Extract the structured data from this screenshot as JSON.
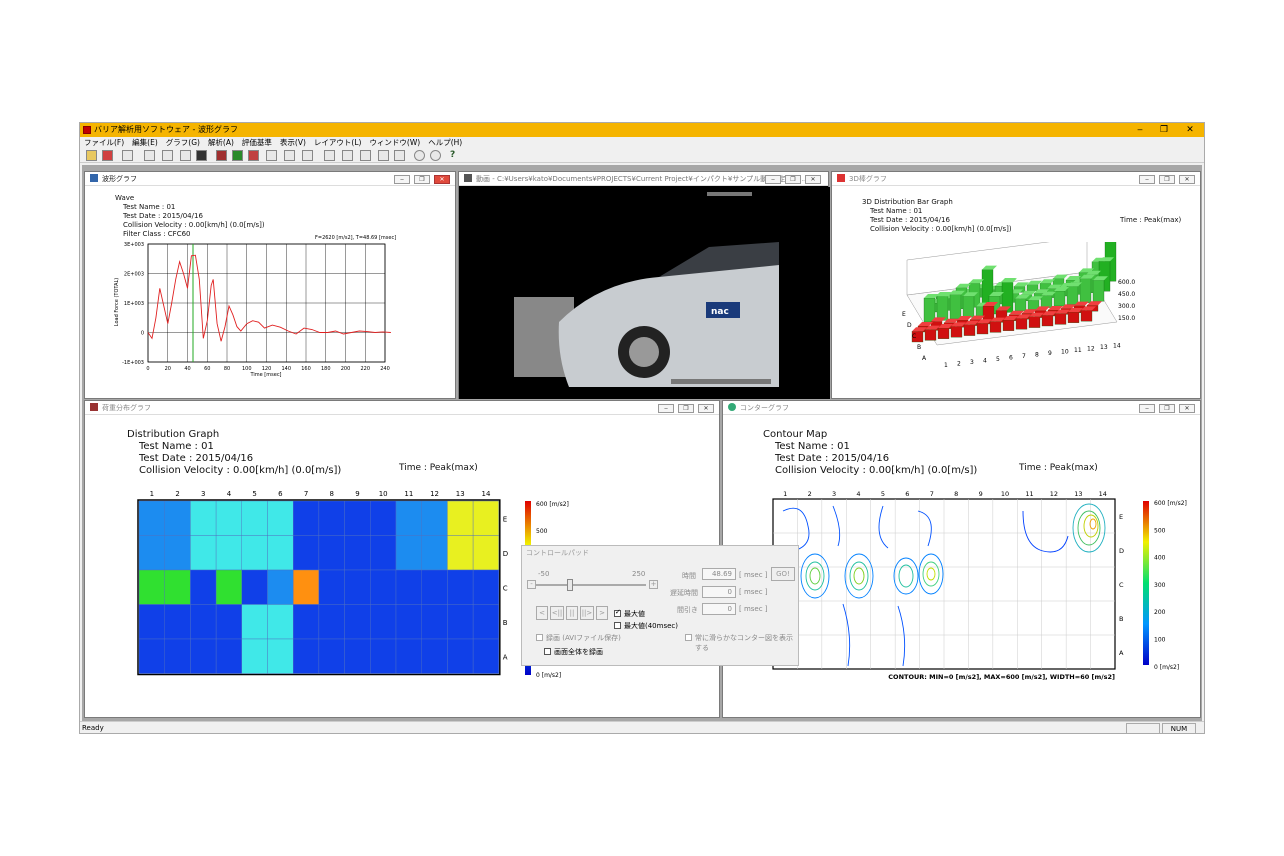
{
  "app": {
    "title": "バリア解析用ソフトウェア - 波形グラフ"
  },
  "menu": [
    "ファイル(F)",
    "編集(E)",
    "グラフ(G)",
    "解析(A)",
    "評価基準",
    "表示(V)",
    "レイアウト(L)",
    "ウィンドウ(W)",
    "ヘルプ(H)"
  ],
  "windows": {
    "wave": {
      "title": "波形グラフ",
      "heading": "Wave",
      "test_name": "Test Name : 01",
      "test_date": "Test Date : 2015/04/16",
      "velocity": "Collision Velocity : 0.00[km/h] (0.0[m/s])",
      "filter": "Filter Class : CFC60",
      "readout": "F=2620 [m/s2],  T=48.69 [msec]",
      "ylabel": "Load Force (TOTAL)",
      "xlabel": "Time [msec]",
      "yticks": [
        "3E+003",
        "2E+003",
        "1E+003",
        "0",
        "-1E+003"
      ],
      "xticks": [
        "0",
        "20",
        "40",
        "60",
        "80",
        "100",
        "120",
        "140",
        "160",
        "180",
        "200",
        "220",
        "240"
      ]
    },
    "video": {
      "title": "動画 - C:¥Users¥kato¥Documents¥PROJECTS¥Current Project¥インパクト¥サンプル動画¥定全要..."
    },
    "bar3d": {
      "title": "3D棒グラフ",
      "heading": "3D Distribution Bar Graph",
      "test_name": "Test Name : 01",
      "test_date": "Test Date : 2015/04/16",
      "velocity": "Collision Velocity : 0.00[km/h] (0.0[m/s])",
      "time": "Time : Peak(max)",
      "zticks": [
        "600.0",
        "450.0",
        "300.0",
        "150.0"
      ],
      "rows": [
        "A",
        "B",
        "C",
        "D",
        "E"
      ],
      "cols": [
        "1",
        "2",
        "3",
        "4",
        "5",
        "6",
        "7",
        "8",
        "9",
        "10",
        "11",
        "12",
        "13",
        "14"
      ]
    },
    "dist": {
      "title": "荷重分布グラフ",
      "heading": "Distribution Graph",
      "test_name": "Test Name : 01",
      "test_date": "Test Date : 2015/04/16",
      "velocity": "Collision Velocity : 0.00[km/h] (0.0[m/s])",
      "time": "Time : Peak(max)",
      "cols": [
        "1",
        "2",
        "3",
        "4",
        "5",
        "6",
        "7",
        "8",
        "9",
        "10",
        "11",
        "12",
        "13",
        "14"
      ],
      "rows": [
        "E",
        "D",
        "C",
        "B",
        "A"
      ],
      "scale_top": "600 [m/s2]",
      "scale_500": "500",
      "scale_bottom": "0 [m/s2]"
    },
    "contour": {
      "title": "コンターグラフ",
      "heading": "Contour Map",
      "test_name": "Test Name : 01",
      "test_date": "Test Date : 2015/04/16",
      "velocity": "Collision Velocity : 0.00[km/h] (0.0[m/s])",
      "time": "Time : Peak(max)",
      "cols": [
        "1",
        "2",
        "3",
        "4",
        "5",
        "6",
        "7",
        "8",
        "9",
        "10",
        "11",
        "12",
        "13",
        "14"
      ],
      "rows": [
        "E",
        "D",
        "C",
        "B",
        "A"
      ],
      "scale": [
        "600 [m/s2]",
        "500",
        "400",
        "300",
        "200",
        "100",
        "0 [m/s2]"
      ],
      "footer": "CONTOUR: MIN=0 [m/s2],  MAX=600 [m/s2],  WIDTH=60 [m/s2]"
    }
  },
  "control_pad": {
    "title": "コントロールパッド",
    "slider_min": "-50",
    "slider_max": "250",
    "time_label": "時間",
    "time_value": "48.69",
    "time_unit": "[ msec ]",
    "go": "GO!",
    "delay_label": "遅延時間",
    "delay_value": "0",
    "delay_unit": "[ msec ]",
    "thin_label": "間引き",
    "thin_value": "0",
    "thin_unit": "[ msec ]",
    "btn_prev": "<",
    "btn_first": "<||",
    "btn_pause": "||",
    "btn_last": "||>",
    "btn_next": ">",
    "btn_minus": "-",
    "btn_plus": "+",
    "max_label": "最大値",
    "max40_label": "最大値(40msec)",
    "record_label": "録画 (AVIファイル保存)",
    "smooth_label": "常に滑らかなコンター図を表示する",
    "fullscreen_label": "画面全体を録画",
    "max_checked": true
  },
  "status": {
    "ready": "Ready",
    "num": "NUM"
  }
}
